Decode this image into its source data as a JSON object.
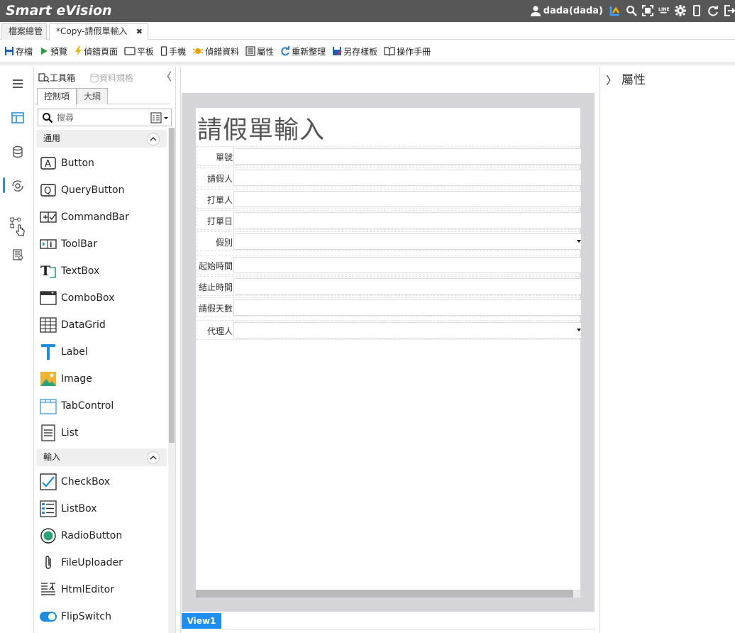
{
  "app": {
    "title": "Smart eVision",
    "username": "dada(dada)"
  },
  "header_icons": [
    "user-icon",
    "brand-icon",
    "search-icon",
    "fullscreen-icon",
    "line-icon",
    "gear-icon",
    "mobile-icon",
    "refresh-icon",
    "logout-icon"
  ],
  "tabs": [
    {
      "label": "檔案總管"
    },
    {
      "label": "*Copy-請假單輸入",
      "close": "✖"
    }
  ],
  "toolbar": {
    "save": "存檔",
    "preview": "預覽",
    "debug_page": "偵錯頁面",
    "tablet": "平板",
    "phone": "手機",
    "debug_data": "偵錯資料",
    "properties": "屬性",
    "reorganize": "重新整理",
    "save_as_template": "另存樣板",
    "manual": "操作手冊"
  },
  "palette": {
    "toolbox_label": "工具箱",
    "data_spec_label": "資料規格",
    "collapse": "〈",
    "tab_controls": "控制項",
    "tab_outline": "大綱",
    "search_placeholder": "搜尋",
    "categories": [
      {
        "label": "通用",
        "items": [
          "Button",
          "QueryButton",
          "CommandBar",
          "ToolBar",
          "TextBox",
          "ComboBox",
          "DataGrid",
          "Label",
          "Image",
          "TabControl",
          "List"
        ]
      },
      {
        "label": "輸入",
        "items": [
          "CheckBox",
          "ListBox",
          "RadioButton",
          "FileUploader",
          "HtmlEditor",
          "FlipSwitch"
        ]
      }
    ]
  },
  "form": {
    "title": "請假單輸入",
    "fields": [
      {
        "label": "單號",
        "type": "text"
      },
      {
        "label": "請假人",
        "type": "text"
      },
      {
        "label": "打單人",
        "type": "text"
      },
      {
        "label": "打單日",
        "type": "text"
      },
      {
        "label": "假別",
        "type": "select"
      },
      {
        "label": "起始時間",
        "type": "text"
      },
      {
        "label": "結止時間",
        "type": "text"
      },
      {
        "label": "請假天數",
        "type": "text"
      },
      {
        "label": "代理人",
        "type": "select"
      }
    ]
  },
  "view_tab": "View1",
  "properties_panel": {
    "title": "屬性",
    "expand": "〉"
  },
  "colors": {
    "titlebar": "#575757",
    "accent": "#1e8ef0",
    "canvas_bg": "#d6d6da"
  }
}
